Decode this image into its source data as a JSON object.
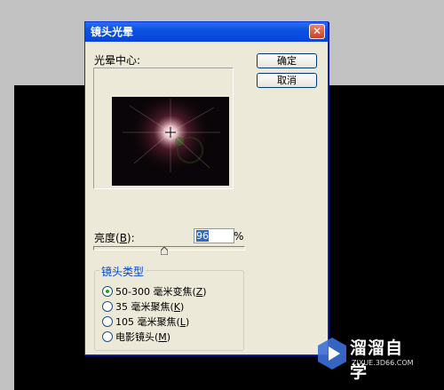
{
  "dialog": {
    "title": "镜头光晕",
    "close_glyph": "✕",
    "flare_center_label": "光晕中心:",
    "ok_label": "确定",
    "cancel_label": "取消",
    "brightness": {
      "label_prefix": "亮度(",
      "label_key": "B",
      "label_suffix": "):",
      "value": "96",
      "unit": "%",
      "slider_value": 96
    },
    "lens_type": {
      "group_label": "镜头类型",
      "options": [
        {
          "prefix": "50-300 毫米变焦(",
          "key": "Z",
          "suffix": ")",
          "selected": true
        },
        {
          "prefix": "35 毫米聚焦(",
          "key": "K",
          "suffix": ")",
          "selected": false
        },
        {
          "prefix": "105 毫米聚焦(",
          "key": "L",
          "suffix": ")",
          "selected": false
        },
        {
          "prefix": "电影镜头(",
          "key": "M",
          "suffix": ")",
          "selected": false
        }
      ]
    }
  },
  "watermark": {
    "brand": "溜溜自学",
    "url": "ZIXUE.3D66.COM"
  },
  "colors": {
    "title_bar": "#0a52e0",
    "dialog_bg": "#ece9d8",
    "group_label": "#0046d5",
    "watermark_bg": "#1f2a5c"
  }
}
